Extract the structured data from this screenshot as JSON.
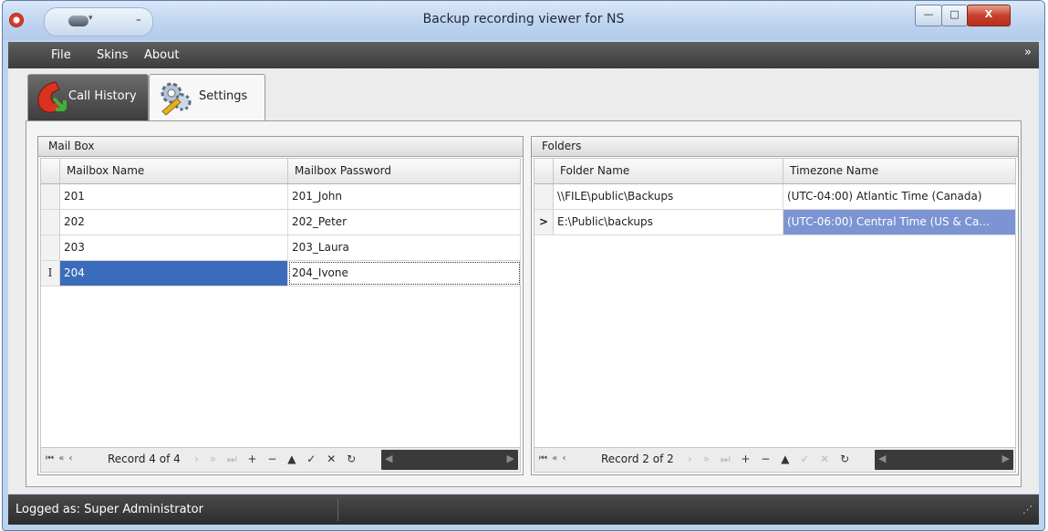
{
  "window": {
    "title": "Backup recording viewer for NS",
    "minimize": "—",
    "maximize": "□",
    "close": "X"
  },
  "qat": {
    "dropdown": "▾",
    "more": "₌"
  },
  "menu": {
    "items": [
      "File",
      "Skins",
      "About"
    ],
    "expand": "»"
  },
  "tabs": [
    {
      "label": "Call History",
      "icon": "phone-icon"
    },
    {
      "label": "Settings",
      "icon": "gears-icon"
    }
  ],
  "mailbox": {
    "title": "Mail Box",
    "columns": [
      "Mailbox Name",
      "Mailbox Password"
    ],
    "rows": [
      {
        "indicator": "",
        "name": "201",
        "password": "201_John"
      },
      {
        "indicator": "",
        "name": "202",
        "password": "202_Peter"
      },
      {
        "indicator": "",
        "name": "203",
        "password": "203_Laura"
      },
      {
        "indicator": "I",
        "name": "204",
        "password": "204_Ivone"
      }
    ],
    "selected_row": 3,
    "record": "Record 4 of 4"
  },
  "folders": {
    "title": "Folders",
    "columns": [
      "Folder Name",
      "Timezone Name"
    ],
    "rows": [
      {
        "indicator": "",
        "folder": "\\\\FILE\\public\\Backups",
        "timezone": "(UTC-04:00) Atlantic Time (Canada)"
      },
      {
        "indicator": ">",
        "folder": "E:\\Public\\backups",
        "timezone": "(UTC-06:00) Central Time (US & Ca..."
      }
    ],
    "selected_row": 1,
    "record": "Record 2 of 2"
  },
  "navigator": {
    "first": "⏮",
    "prev_page": "«",
    "prev": "‹",
    "next": "›",
    "next_page": "»",
    "last": "⏭",
    "add": "+",
    "remove": "−",
    "edit": "▲",
    "apply": "✓",
    "cancel": "✕",
    "refresh": "↻",
    "scroll_left": "◀",
    "scroll_right": "▶"
  },
  "status": {
    "text": "Logged as: Super Administrator",
    "grip": "⋰"
  },
  "colors": {
    "selection": "#3b6cbb",
    "selection_inactive": "#7c94d3",
    "menubar": "#3c3c3c",
    "titlebar": "#bed4ef"
  }
}
